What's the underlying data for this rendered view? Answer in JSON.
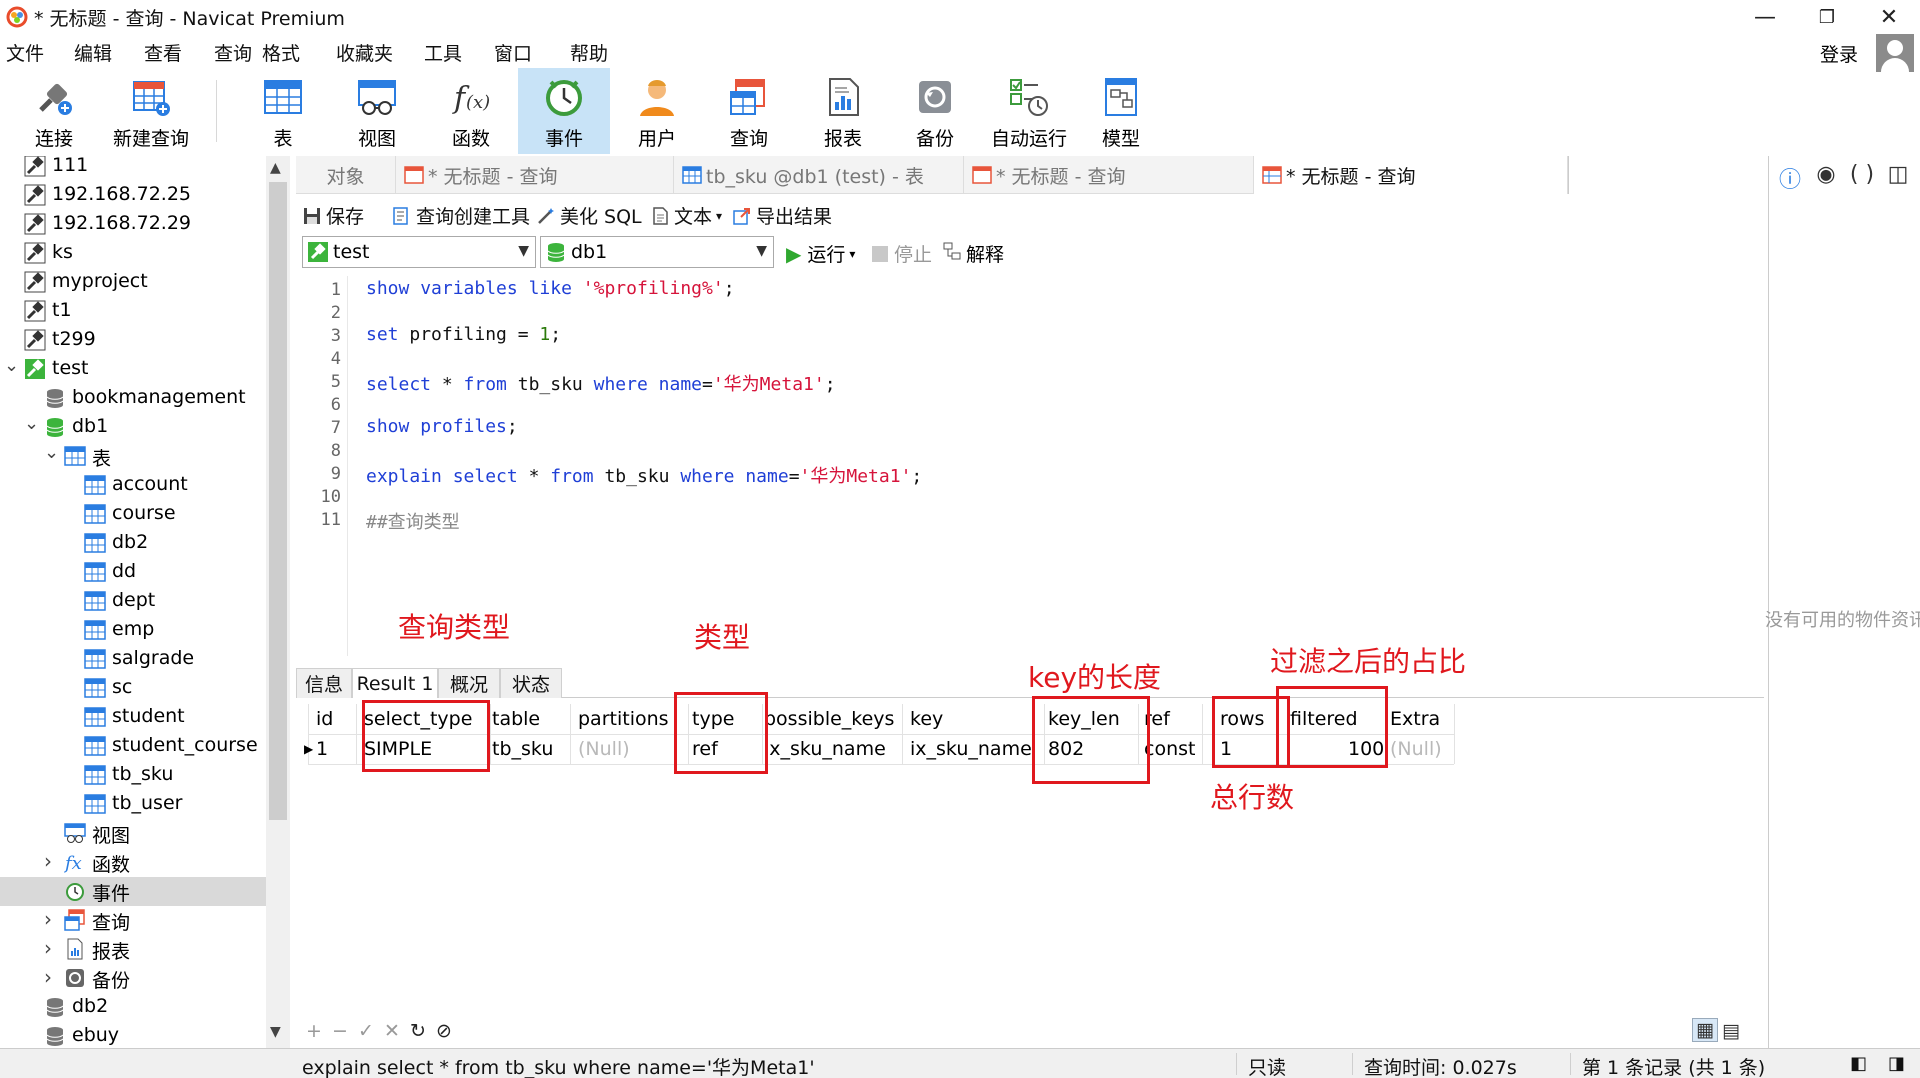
{
  "window": {
    "title": "* 无标题 - 查询 - Navicat Premium",
    "minimize": "—",
    "restore": "❐",
    "close": "✕"
  },
  "menu": [
    "文件",
    "编辑",
    "查看",
    "查询",
    "格式",
    "收藏夹",
    "工具",
    "窗口",
    "帮助"
  ],
  "login_label": "登录",
  "toolbar": [
    {
      "label": "连接",
      "icon": "plug-icon"
    },
    {
      "label": "新建查询",
      "icon": "new-query-icon"
    },
    {
      "label": "表",
      "icon": "table-icon"
    },
    {
      "label": "视图",
      "icon": "view-icon"
    },
    {
      "label": "函数",
      "icon": "function-icon"
    },
    {
      "label": "事件",
      "icon": "clock-icon"
    },
    {
      "label": "用户",
      "icon": "user-icon"
    },
    {
      "label": "查询",
      "icon": "query-icon"
    },
    {
      "label": "报表",
      "icon": "report-icon"
    },
    {
      "label": "备份",
      "icon": "backup-icon"
    },
    {
      "label": "自动运行",
      "icon": "autorun-icon"
    },
    {
      "label": "模型",
      "icon": "model-icon"
    }
  ],
  "tree": {
    "connections": [
      "111",
      "192.168.72.25",
      "192.168.72.29",
      "ks",
      "myproject",
      "t1",
      "t299",
      "test"
    ],
    "test_children": [
      "bookmanagement",
      "db1"
    ],
    "db1_children": [
      "表"
    ],
    "tables": [
      "account",
      "course",
      "db2",
      "dd",
      "dept",
      "emp",
      "salgrade",
      "sc",
      "student",
      "student_course",
      "tb_sku",
      "tb_user"
    ],
    "db1_other": [
      "视图",
      "函数",
      "事件",
      "查询",
      "报表",
      "备份"
    ],
    "more_dbs": [
      "db2",
      "ebuy"
    ]
  },
  "tabs": [
    {
      "label": "对象"
    },
    {
      "label": "* 无标题 - 查询"
    },
    {
      "label": "tb_sku @db1 (test) - 表"
    },
    {
      "label": "* 无标题 - 查询"
    },
    {
      "label": "* 无标题 - 查询"
    }
  ],
  "query_toolbar": {
    "save": "保存",
    "builder": "查询创建工具",
    "beautify": "美化 SQL",
    "text": "文本",
    "export": "导出结果"
  },
  "connection_select": "test",
  "database_select": "db1",
  "run_label": "运行",
  "stop_label": "停止",
  "explain_label": "解释",
  "editor": {
    "line_numbers": [
      "1",
      "2",
      "3",
      "4",
      "5",
      "6",
      "7",
      "8",
      "9",
      "10",
      "11"
    ],
    "line1": {
      "a": "show",
      "b": " ",
      "c": "variables",
      "d": " ",
      "e": "like",
      "f": " ",
      "g": "'%profiling%'",
      "h": ";"
    },
    "line3": {
      "a": "set",
      "b": " profiling = ",
      "c": "1",
      "d": ";"
    },
    "line5": {
      "a": "select",
      "b": " * ",
      "c": "from",
      "d": " tb_sku ",
      "e": "where",
      "f": " ",
      "g": "name",
      "h": "=",
      "i": "'华为Meta1'",
      "j": ";"
    },
    "line7": {
      "a": "show",
      "b": " ",
      "c": "profiles",
      "d": ";"
    },
    "line9": {
      "a": "explain",
      "b": " ",
      "c": "select",
      "d": " * ",
      "e": "from",
      "f": " tb_sku ",
      "g": "where",
      "h": " ",
      "i": "name",
      "j": "=",
      "k": "'华为Meta1'",
      "l": ";"
    },
    "line11": "##查询类型"
  },
  "annotations": {
    "query_type": "查询类型",
    "type": "类型",
    "key_length": "key的长度",
    "filtered_ratio": "过滤之后的占比",
    "total_rows": "总行数"
  },
  "result_tabs": [
    "信息",
    "Result 1",
    "概况",
    "状态"
  ],
  "result": {
    "columns": [
      "id",
      "select_type",
      "table",
      "partitions",
      "type",
      "possible_keys",
      "key",
      "key_len",
      "ref",
      "rows",
      "filtered",
      "Extra"
    ],
    "row": [
      "1",
      "SIMPLE",
      "tb_sku",
      "(Null)",
      "ref",
      "ix_sku_name",
      "ix_sku_name",
      "802",
      "const",
      "1",
      "100",
      "(Null)"
    ]
  },
  "info_panel_hint": "没有可用的物件资讯",
  "status": {
    "sql": "explain select * from tb_sku where name='华为Meta1'",
    "mode": "只读",
    "query_time": "查询时间: 0.027s",
    "record": "第 1 条记录 (共 1 条)"
  },
  "colors": {
    "accent": "#c8e3f7",
    "annotation": "#e0181e",
    "keyword": "#1f3fd6",
    "string": "#d6143b"
  }
}
